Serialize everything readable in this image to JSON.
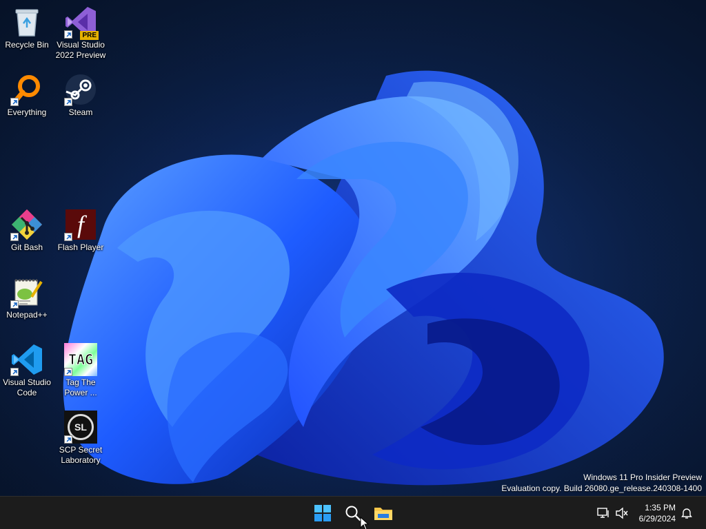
{
  "desktop_icons": [
    {
      "label": "Recycle Bin",
      "icon": "recycle-bin-icon"
    },
    {
      "label": "Visual Studio 2022 Preview",
      "icon": "visual-studio-icon",
      "badge": "PRE"
    },
    {
      "label": "Everything",
      "icon": "everything-search-icon"
    },
    {
      "label": "Steam",
      "icon": "steam-icon"
    },
    {
      "label": "Git Bash",
      "icon": "git-bash-icon"
    },
    {
      "label": "Flash Player",
      "icon": "flash-player-icon",
      "glyph": "f"
    },
    {
      "label": "Notepad++",
      "icon": "notepad-plus-plus-icon"
    },
    {
      "label": "Visual Studio Code",
      "icon": "vscode-icon"
    },
    {
      "label": "Tag The Power ...",
      "icon": "tag-the-power-icon",
      "glyph": "TAG"
    },
    {
      "label": "SCP Secret Laboratory",
      "icon": "scp-secret-laboratory-icon",
      "glyph": "SL"
    }
  ],
  "watermark": {
    "line1": "Windows 11 Pro Insider Preview",
    "line2": "Evaluation copy. Build 26080.ge_release.240308-1400"
  },
  "taskbar": {
    "pinned": [
      {
        "name": "start-button",
        "icon": "windows-logo-icon"
      },
      {
        "name": "search-button",
        "icon": "search-icon"
      },
      {
        "name": "file-explorer-button",
        "icon": "folder-icon"
      }
    ],
    "tray": {
      "network_icon": "network-icon",
      "volume_icon": "volume-muted-icon",
      "notification_icon": "bell-icon"
    },
    "clock": {
      "time": "1:35 PM",
      "date": "6/29/2024"
    }
  },
  "colors": {
    "accent": "#1e6bff",
    "taskbar": "#1c1c1c",
    "wallpaper_bg": "#0b1f45"
  }
}
